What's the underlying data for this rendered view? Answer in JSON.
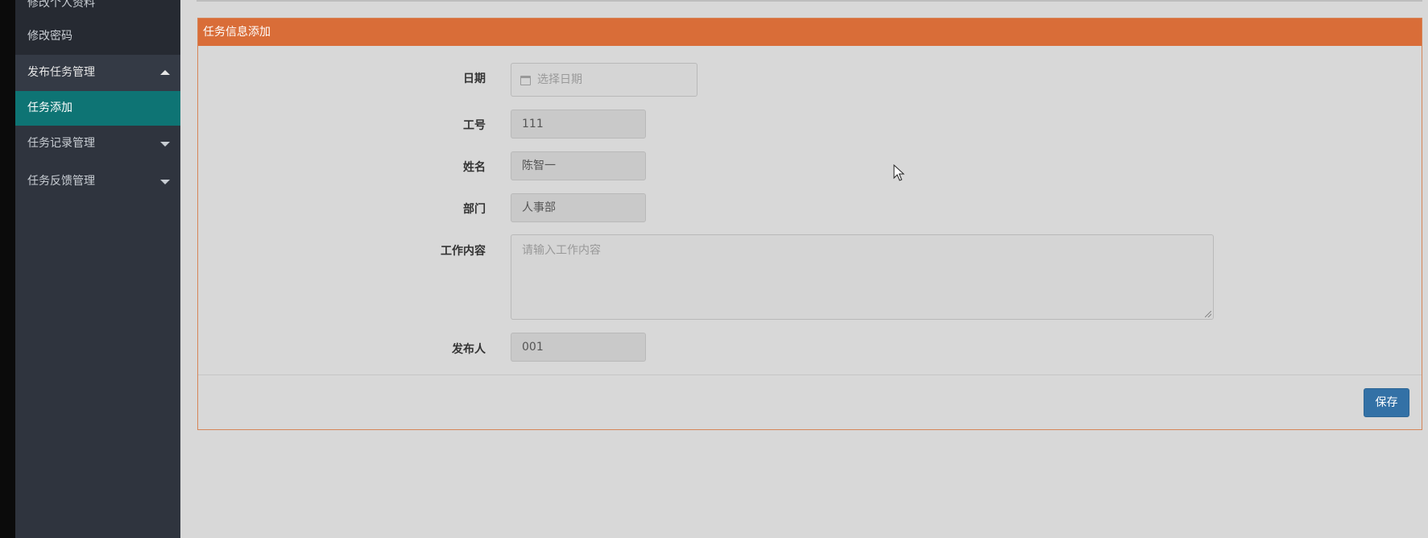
{
  "sidebar": {
    "items": [
      {
        "label": "修改个人资料"
      },
      {
        "label": "修改密码"
      },
      {
        "label": "发布任务管理"
      },
      {
        "label": "任务添加"
      },
      {
        "label": "任务记录管理"
      },
      {
        "label": "任务反馈管理"
      }
    ]
  },
  "panel": {
    "title": "任务信息添加",
    "save_label": "保存"
  },
  "form": {
    "date": {
      "label": "日期",
      "placeholder": "选择日期"
    },
    "employee_id": {
      "label": "工号",
      "value": "111"
    },
    "name": {
      "label": "姓名",
      "value": "陈智一"
    },
    "department": {
      "label": "部门",
      "value": "人事部"
    },
    "content": {
      "label": "工作内容",
      "placeholder": "请输入工作内容"
    },
    "publisher": {
      "label": "发布人",
      "value": "001"
    }
  },
  "colors": {
    "sidebar_bg": "#2f343e",
    "sidebar_active": "#0e7474",
    "panel_header": "#d96d38",
    "save_button": "#3371a6"
  }
}
